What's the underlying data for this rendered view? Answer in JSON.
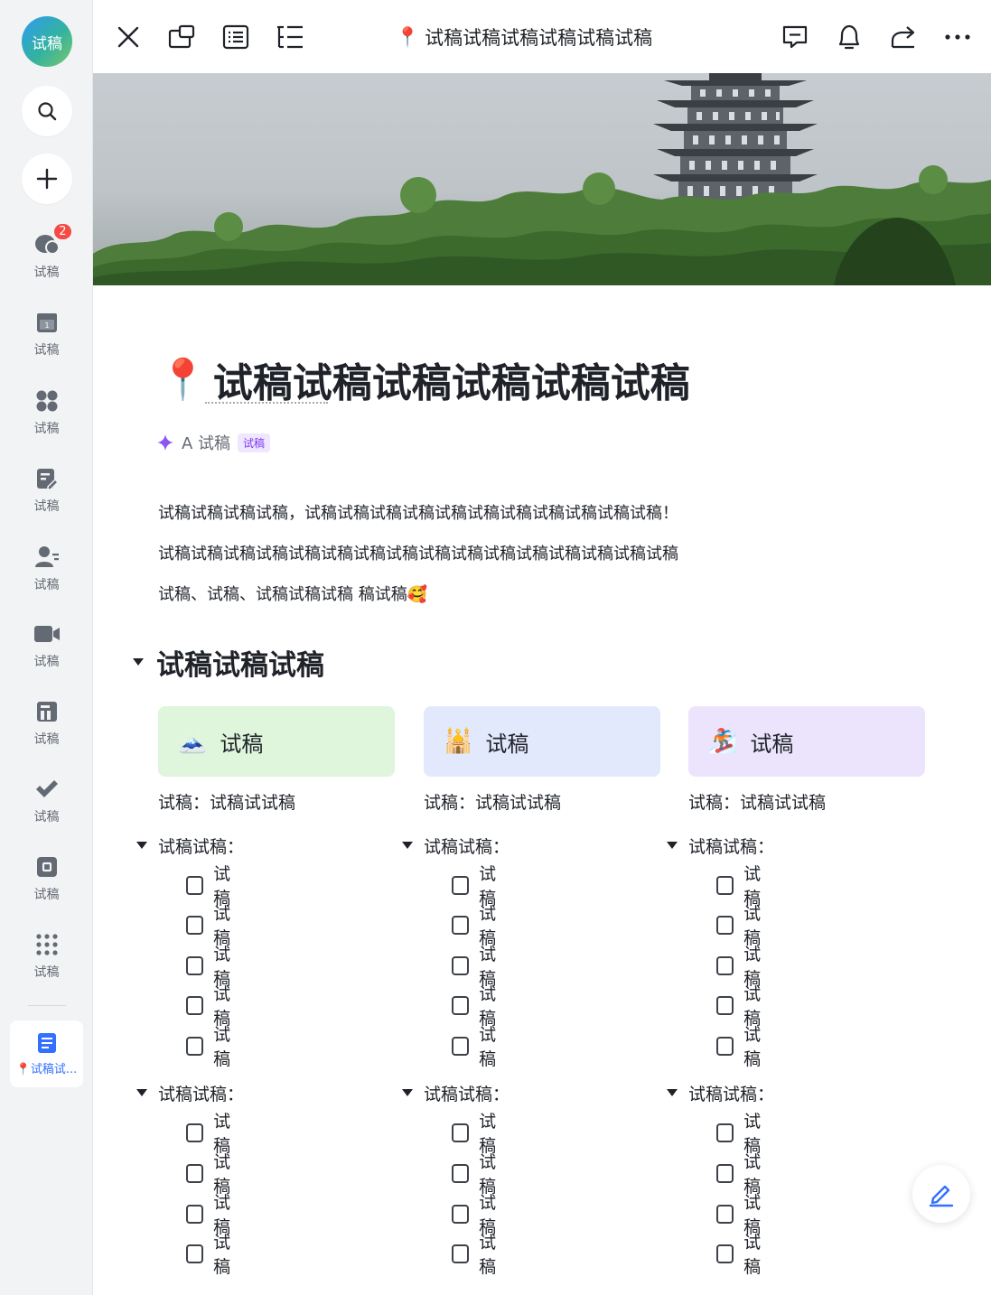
{
  "sidebar": {
    "avatar_text": "试稿",
    "items": [
      {
        "label": "试稿",
        "icon": "chat-bubble-icon",
        "badge": "2"
      },
      {
        "label": "试稿",
        "icon": "calendar-icon"
      },
      {
        "label": "试稿",
        "icon": "workspace-grid-icon"
      },
      {
        "label": "试稿",
        "icon": "docs-edit-icon"
      },
      {
        "label": "试稿",
        "icon": "contacts-icon"
      },
      {
        "label": "试稿",
        "icon": "video-meeting-icon"
      },
      {
        "label": "试稿",
        "icon": "wiki-icon"
      },
      {
        "label": "试稿",
        "icon": "approval-check-icon"
      },
      {
        "label": "试稿",
        "icon": "app-center-icon"
      },
      {
        "label": "试稿",
        "icon": "more-apps-icon"
      }
    ],
    "active_doc_label": "📍试稿试..."
  },
  "topbar": {
    "doc_title": "试稿试稿试稿试稿试稿试稿",
    "pin_emoji": "📍"
  },
  "doc": {
    "pin_emoji": "📍",
    "title": "试稿试稿试稿试稿试稿试稿",
    "ai_label": "A 试稿",
    "ai_tag": "试稿",
    "paragraphs": [
      "试稿试稿试稿试稿，试稿试稿试稿试稿试稿试稿试稿试稿试稿试稿试稿！",
      "试稿试稿试稿试稿试稿试稿试稿试稿试稿试稿试稿试稿试稿试稿试稿试稿",
      "试稿、试稿、试稿试稿试稿 稿试稿🥰"
    ],
    "section_title": "试稿试稿试稿",
    "columns": [
      {
        "emoji": "🗻",
        "card_title": "试稿",
        "card_color": "#dff5dc",
        "kv": "试稿：试稿试试稿",
        "groups": [
          {
            "title": "试稿试稿：",
            "tasks": [
              "试稿",
              "试稿",
              "试稿",
              "试稿",
              "试稿"
            ]
          },
          {
            "title": "试稿试稿：",
            "tasks": [
              "试稿",
              "试稿",
              "试稿",
              "试稿"
            ]
          }
        ]
      },
      {
        "emoji": "🕌",
        "card_title": "试稿",
        "card_color": "#e2e9fd",
        "kv": "试稿：试稿试试稿",
        "groups": [
          {
            "title": "试稿试稿：",
            "tasks": [
              "试稿",
              "试稿",
              "试稿",
              "试稿",
              "试稿"
            ]
          },
          {
            "title": "试稿试稿：",
            "tasks": [
              "试稿",
              "试稿",
              "试稿",
              "试稿"
            ]
          }
        ]
      },
      {
        "emoji": "🏂",
        "card_title": "试稿",
        "card_color": "#ece4fc",
        "kv": "试稿：试稿试试稿",
        "groups": [
          {
            "title": "试稿试稿：",
            "tasks": [
              "试稿",
              "试稿",
              "试稿",
              "试稿",
              "试稿"
            ]
          },
          {
            "title": "试稿试稿：",
            "tasks": [
              "试稿",
              "试稿",
              "试稿",
              "试稿"
            ]
          }
        ]
      }
    ]
  },
  "colors": {
    "accent": "#3370ff",
    "badge": "#f54a45",
    "ai_purple": "#7f3bf5"
  }
}
